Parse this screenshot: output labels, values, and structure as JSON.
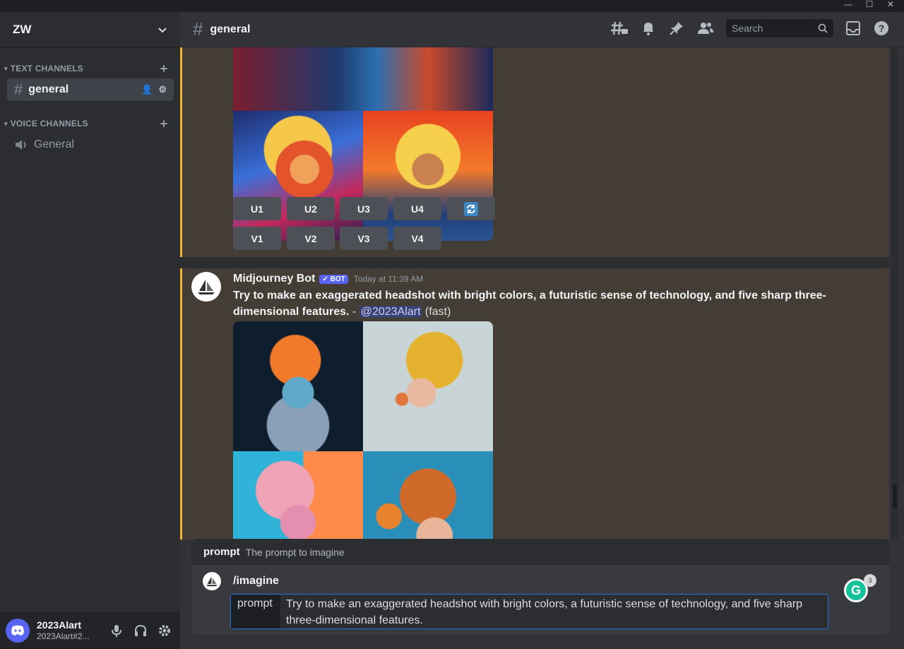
{
  "window": {
    "minimize": "—",
    "maximize": "☐",
    "close": "✕"
  },
  "server": {
    "name": "ZW"
  },
  "sidebar": {
    "text_category": "TEXT CHANNELS",
    "voice_category": "VOICE CHANNELS",
    "text_channels": [
      {
        "name": "general"
      }
    ],
    "voice_channels": [
      {
        "name": "General"
      }
    ]
  },
  "user": {
    "name": "2023Alart",
    "tag": "2023Alart#2..."
  },
  "header": {
    "channel": "general",
    "search_placeholder": "Search"
  },
  "prev_message": {
    "upscale_buttons": [
      "U1",
      "U2",
      "U3",
      "U4"
    ],
    "variation_buttons": [
      "V1",
      "V2",
      "V3",
      "V4"
    ]
  },
  "message": {
    "author": "Midjourney Bot",
    "badge": "✓ BOT",
    "timestamp": "Today at 11:39 AM",
    "prompt_bold": "Try to make an exaggerated headshot with bright colors, a futuristic sense of technology, and five sharp three-dimensional features.",
    "separator": " - ",
    "mention": "@2023Alart",
    "mode": "(fast)"
  },
  "composer": {
    "option_name": "prompt",
    "option_desc": "The prompt to imagine",
    "command": "/imagine",
    "param_key": "prompt",
    "param_value": "Try to make an exaggerated headshot with bright colors, a futuristic sense of technology, and five sharp three-dimensional features.",
    "grammarly_count": "3"
  },
  "colors": {
    "accent": "#5865f2",
    "highlight_bar": "#f0b232",
    "focus_border": "#2a6fdb"
  }
}
